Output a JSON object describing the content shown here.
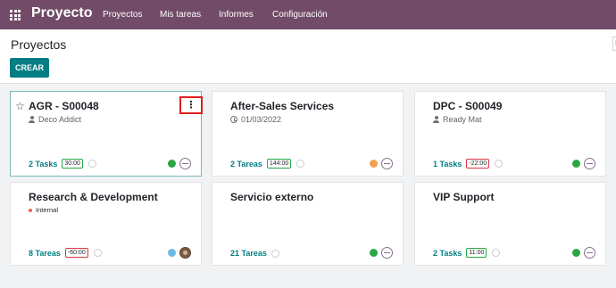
{
  "navbar": {
    "brand": "Proyecto",
    "menu": [
      "Proyectos",
      "Mis tareas",
      "Informes",
      "Configuración"
    ]
  },
  "control": {
    "breadcrumb": "Proyectos",
    "create_label": "CREAR",
    "search_edge": "B"
  },
  "colors": {
    "navbar": "#714b67",
    "primary": "#017e84",
    "status_green": "#28a745",
    "status_orange": "#f0a050",
    "status_blue": "#6cb8e6",
    "highlight_red": "#e01e1e"
  },
  "projects": [
    {
      "name": "AGR - S00048",
      "subtitle": "Deco Addict",
      "subtitle_icon": "person-icon",
      "tasks": "2 Tasks",
      "hours": "30:00",
      "hours_state": "ok",
      "status": "green",
      "avatar": "placeholder",
      "favorite": "star-outline",
      "menu_icon": "⋮"
    },
    {
      "name": "After-Sales Services",
      "subtitle": "01/03/2022",
      "subtitle_icon": "clock-icon",
      "tasks": "2 Tareas",
      "hours": "144:00",
      "hours_state": "ok",
      "status": "orange",
      "avatar": "placeholder"
    },
    {
      "name": "DPC - S00049",
      "subtitle": "Ready Mat",
      "subtitle_icon": "person-icon",
      "tasks": "1 Tasks",
      "hours": "-22:00",
      "hours_state": "bad",
      "status": "green",
      "avatar": "placeholder"
    },
    {
      "name": "Research & Development",
      "subtitle": "Internal",
      "subtitle_icon": "tag-dot",
      "tasks": "8 Tareas",
      "hours": "-60:00",
      "hours_state": "bad",
      "status": "blue",
      "avatar": "photo"
    },
    {
      "name": "Servicio externo",
      "subtitle": "",
      "tasks": "21 Tareas",
      "hours": "",
      "status": "green",
      "avatar": "placeholder"
    },
    {
      "name": "VIP Support",
      "subtitle": "",
      "tasks": "2 Tasks",
      "hours": "11:00",
      "hours_state": "ok",
      "status": "green",
      "avatar": "placeholder"
    }
  ]
}
